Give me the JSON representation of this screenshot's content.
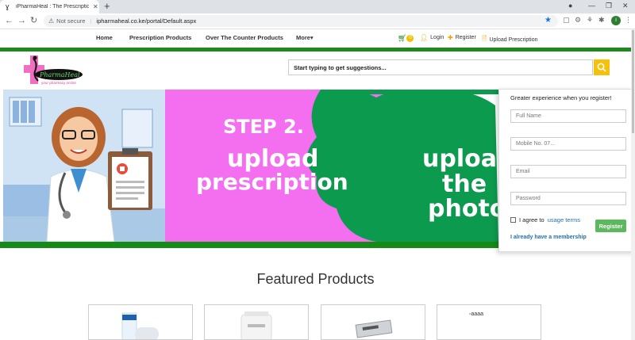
{
  "browser": {
    "tab_title": "iPharmaHeal : The Prescriptions",
    "not_secure": "Not secure",
    "url": "ipharmaheal.co.ke/portal/Default.aspx",
    "profile_initial": "i"
  },
  "nav": {
    "items": [
      "Home",
      "Prescription Products",
      "Over The Counter Products",
      "More"
    ],
    "cart_count": "0",
    "login": "Login",
    "register": "Register",
    "upload": "Upload Prescription"
  },
  "header": {
    "search_placeholder": "Start typing to get suggestions..."
  },
  "hero": {
    "step": "STEP 2.",
    "line1": "upload",
    "line2": "prescription",
    "right1": "upload",
    "right2": "the",
    "right3": "photo"
  },
  "register_panel": {
    "title": "Greater experience when you register!",
    "full_name": "Full Name",
    "mobile": "Mobile No. 07...",
    "email": "Email",
    "password": "Password",
    "agree_text": "I agree to",
    "agree_link": "usage terms",
    "button": "Register",
    "membership_link": "I already have a membership"
  },
  "featured": {
    "title": "Featured Products",
    "broken_alt": "aaaa"
  },
  "colors": {
    "brand_green": "#1e8a1e",
    "hero_pink": "#f46ff0",
    "hero_green": "#0c9a4e",
    "accent_yellow": "#f4c20d",
    "register_green": "#5cb85c"
  }
}
